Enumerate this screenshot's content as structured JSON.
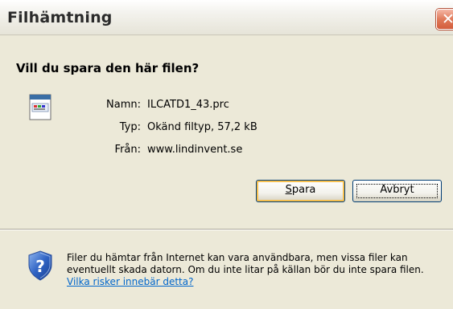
{
  "window": {
    "title": "Filhämtning",
    "close_glyph": "✕"
  },
  "dialog": {
    "question": "Vill du spara den här filen?",
    "file_icon": "file-icon",
    "fields": [
      {
        "label": "Namn:",
        "value": "ILCATD1_43.prc"
      },
      {
        "label": "Typ:",
        "value": "Okänd filtyp, 57,2 kB"
      },
      {
        "label": "Från:",
        "value": "www.lindinvent.se"
      }
    ],
    "save_label": "Spara",
    "cancel_label": "Avbryt",
    "warning_icon": "security-shield-icon",
    "warning_text": "Filer du hämtar från Internet kan vara användbara, men vissa filer kan eventuellt skada datorn. Om du inte litar på källan bör du inte spara filen. ",
    "warning_link": "Vilka risker innebär detta?"
  },
  "colors": {
    "dialog_bg": "#ece9d8",
    "link": "#0066cc",
    "close_button": "#d35d3c",
    "default_button_highlight": "#f6c050"
  }
}
